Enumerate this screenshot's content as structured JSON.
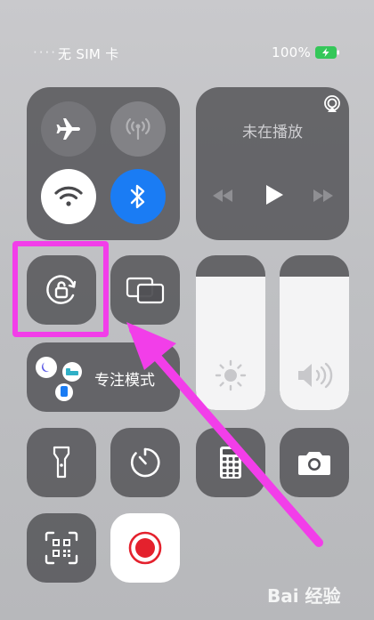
{
  "status_bar": {
    "carrier": "无 SIM 卡",
    "battery_percent": "100%"
  },
  "now_playing": {
    "label": "未在播放"
  },
  "focus": {
    "label": "专注模式"
  },
  "sliders": {
    "brightness_level": 0.86,
    "volume_level": 0.86
  },
  "colors": {
    "accent_blue": "#1a7cf4",
    "highlight_pink": "#f23ee9",
    "battery_green": "#34c759",
    "record_red": "#e4212d"
  },
  "watermark": {
    "text": "Bai 经验"
  }
}
